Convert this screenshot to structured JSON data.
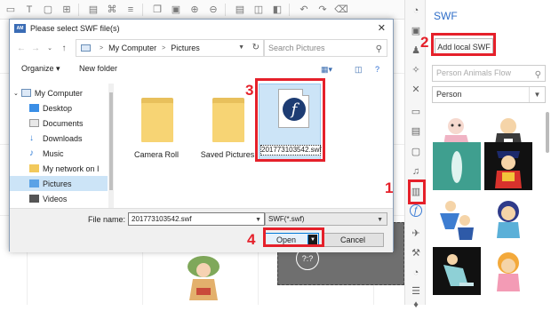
{
  "toolbar": {
    "icons": [
      "shapes-icon",
      "text-icon",
      "image-icon",
      "grid-icon",
      "table-icon",
      "link-icon",
      "zoom-in-icon",
      "zoom-out-icon",
      "lock-icon",
      "group-icon",
      "layers-icon",
      "undo-icon",
      "redo-icon",
      "delete-icon"
    ]
  },
  "canvas": {
    "placeholder_text": "?:?"
  },
  "icon_strip": {
    "icons": [
      "shapes-icon",
      "image-icon",
      "person-icon",
      "wand-icon",
      "tools-icon",
      "chat-icon",
      "note-icon",
      "folder-icon",
      "music-icon",
      "film-icon",
      "swf-icon",
      "plane-icon",
      "wrench-icon",
      "chart-icon",
      "stack-icon",
      "sigma-icon",
      "drop-icon"
    ],
    "active": "swf-icon"
  },
  "panel": {
    "title": "SWF",
    "add_button": "Add local SWF",
    "search_placeholder": "Person Animals Flow",
    "category": "Person"
  },
  "dialog": {
    "title": "Please select SWF file(s)",
    "app_icon_text": "AM",
    "breadcrumb": [
      "My Computer",
      "Pictures"
    ],
    "search_placeholder": "Search Pictures",
    "organize_label": "Organize",
    "new_folder_label": "New folder",
    "nav_items": [
      {
        "label": "My Computer",
        "icon": "computer-icon",
        "selected": false
      },
      {
        "label": "Desktop",
        "icon": "desktop-icon",
        "selected": false
      },
      {
        "label": "Documents",
        "icon": "documents-icon",
        "selected": false
      },
      {
        "label": "Downloads",
        "icon": "downloads-icon",
        "selected": false
      },
      {
        "label": "Music",
        "icon": "music-icon",
        "selected": false
      },
      {
        "label": "My network on I",
        "icon": "network-folder-icon",
        "selected": false
      },
      {
        "label": "Pictures",
        "icon": "pictures-icon",
        "selected": true
      },
      {
        "label": "Videos",
        "icon": "videos-icon",
        "selected": false
      }
    ],
    "files": [
      {
        "name": "Camera Roll",
        "type": "folder"
      },
      {
        "name": "Saved Pictures",
        "type": "folder"
      },
      {
        "name": "201773103542.swf",
        "type": "swf",
        "selected": true
      }
    ],
    "file_name_label": "File name:",
    "file_name_value": "201773103542.swf",
    "file_type": "SWF(*.swf)",
    "open_label": "Open",
    "cancel_label": "Cancel"
  },
  "callouts": [
    "1",
    "2",
    "3",
    "4"
  ],
  "colors": {
    "accent": "#2f6ec8",
    "callout": "#e5202a",
    "selection": "#cce4f7",
    "folder": "#f7d474"
  }
}
